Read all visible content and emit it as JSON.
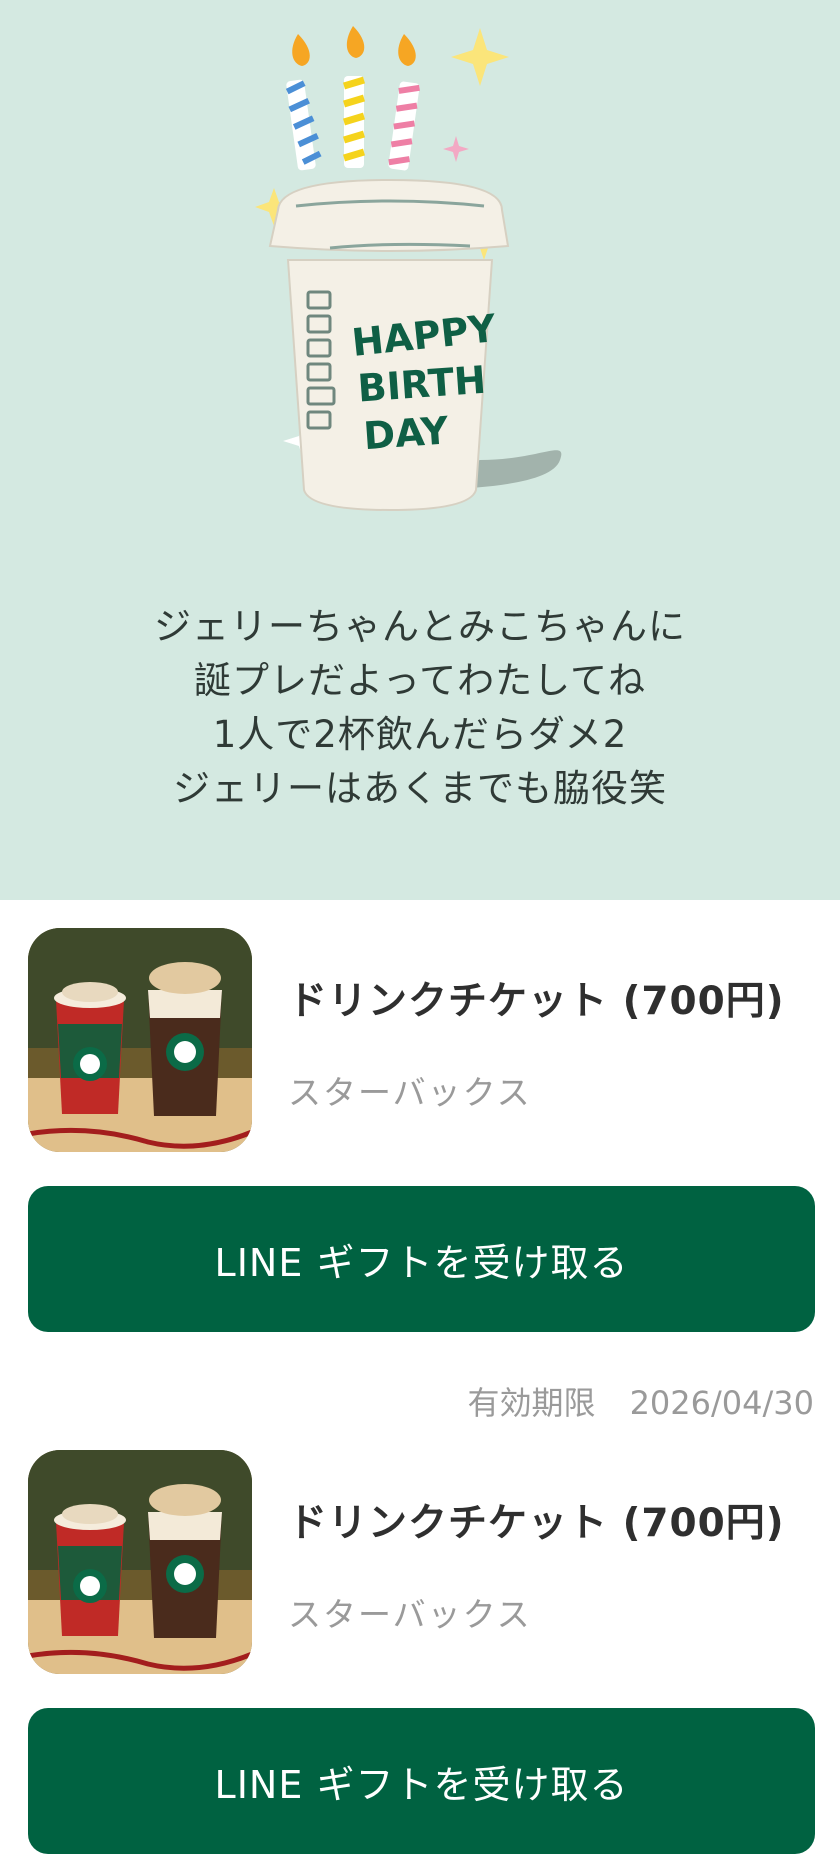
{
  "illustration": {
    "icon": "birthday-cup-illustration",
    "cup_text": [
      "HAPPY",
      "BIRTH",
      "DAY"
    ]
  },
  "message": {
    "lines": [
      "ジェリーちゃんとみこちゃんに",
      "誕プレだよってわたしてね",
      "1人で2杯飲んだらダメ2",
      "ジェリーはあくまでも脇役笑"
    ]
  },
  "gifts": [
    {
      "title": "ドリンクチケット (700円)",
      "brand": "スターバックス",
      "button_label": "LINE ギフトを受け取る",
      "expiry_label": "有効期限",
      "expiry_date": "2026/04/30"
    },
    {
      "title": "ドリンクチケット (700円)",
      "brand": "スターバックス",
      "button_label": "LINE ギフトを受け取る"
    }
  ],
  "colors": {
    "header_bg": "#d4e9e1",
    "button_bg": "#006241",
    "button_text": "#ffffff"
  }
}
